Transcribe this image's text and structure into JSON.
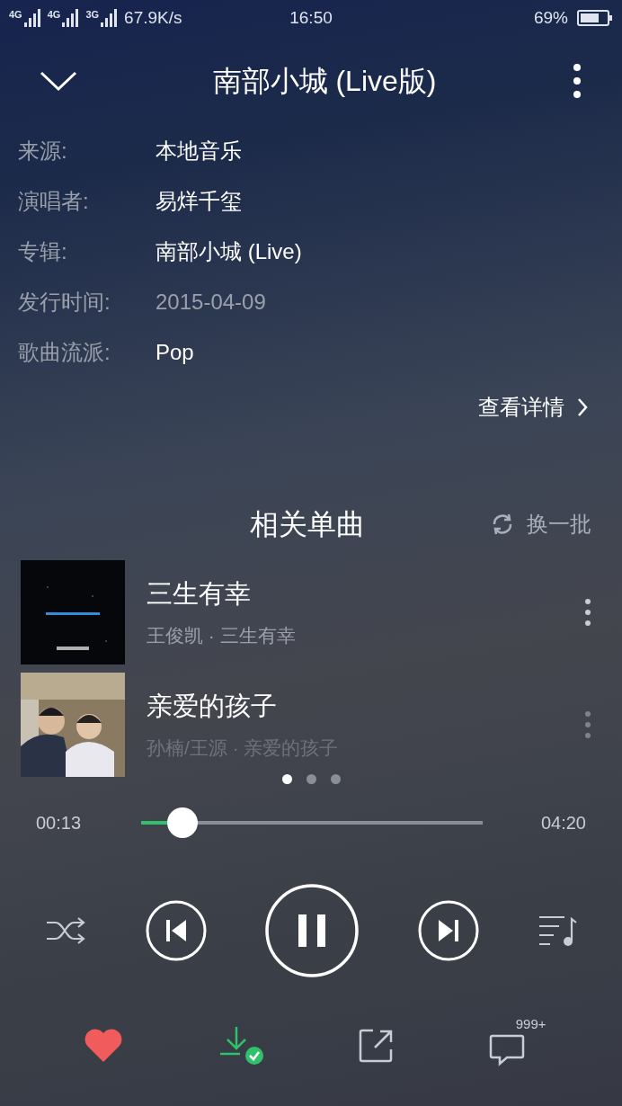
{
  "status_bar": {
    "network_labels": [
      "4G",
      "4G",
      "3G"
    ],
    "speed": "67.9K/s",
    "time": "16:50",
    "battery": "69%"
  },
  "header": {
    "title": "南部小城 (Live版)"
  },
  "info": [
    {
      "label": "来源:",
      "value": "本地音乐",
      "dimmed": false
    },
    {
      "label": "演唱者:",
      "value": "易烊千玺",
      "dimmed": false
    },
    {
      "label": "专辑:",
      "value": "南部小城 (Live)",
      "dimmed": false
    },
    {
      "label": "发行时间:",
      "value": "2015-04-09",
      "dimmed": true
    },
    {
      "label": "歌曲流派:",
      "value": "Pop",
      "dimmed": false
    }
  ],
  "details_link": "查看详情",
  "related": {
    "title": "相关单曲",
    "refresh": "换一批",
    "songs": [
      {
        "title": "三生有幸",
        "subtitle": "王俊凯 · 三生有幸",
        "faded": false
      },
      {
        "title": "亲爱的孩子",
        "subtitle": "孙楠/王源 · 亲爱的孩子",
        "faded": true
      }
    ],
    "pages": [
      {
        "selected": true
      },
      {
        "selected": false
      },
      {
        "selected": false
      }
    ]
  },
  "progress": {
    "elapsed": "00:13",
    "total": "04:20",
    "level": 0.08
  },
  "player": {
    "playing": true
  },
  "actions": {
    "liked": true,
    "downloaded": true,
    "comment_count": "999+"
  }
}
